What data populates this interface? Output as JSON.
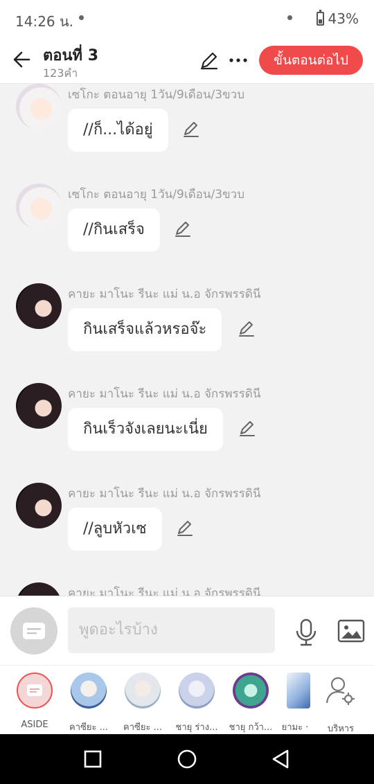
{
  "status": {
    "time": "14:26 น.",
    "battery": "43%"
  },
  "header": {
    "title": "ตอนที่ 3",
    "subtitle": "123คำ",
    "next_label": "ขั้นตอนต่อไป"
  },
  "messages": [
    {
      "sender": "เซโกะ ตอนอายุ 1วัน/9เดือน/3ขวบ",
      "text": "//ก็...ได้อยู่"
    },
    {
      "sender": "เซโกะ ตอนอายุ 1วัน/9เดือน/3ขวบ",
      "text": "//กินเสร็จ"
    },
    {
      "sender": "คายะ มาโนะ รีนะ แม่ น.อ จักรพรรดินี",
      "text": "กินเสร็จแล้วหรอจ๊ะ"
    },
    {
      "sender": "คายะ มาโนะ รีนะ แม่ น.อ จักรพรรดินี",
      "text": "กินเร็วจังเลยนะเนี่ย"
    },
    {
      "sender": "คายะ มาโนะ รีนะ แม่ น.อ จักรพรรดินี",
      "text": "//ลูบหัวเซ"
    },
    {
      "sender": "คายะ มาโนะ รีนะ แม่ น.อ จักรพรรดินี",
      "text": ""
    }
  ],
  "input": {
    "placeholder": "พูดอะไรบ้าง"
  },
  "characters": [
    {
      "label": "ASIDE"
    },
    {
      "label": "คาซียะ ..."
    },
    {
      "label": "คาซียะ ..."
    },
    {
      "label": "ชายุ ร่าง..."
    },
    {
      "label": "ชายุ กว้า..."
    },
    {
      "label": "ยามะ ·"
    },
    {
      "label": "บริหาร"
    }
  ]
}
